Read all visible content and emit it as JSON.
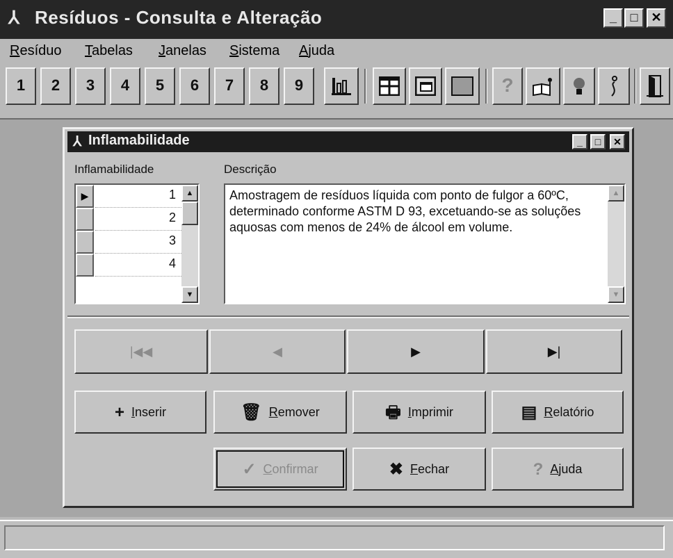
{
  "window": {
    "title": "Resíduos - Consulta e Alteração",
    "app_icon": "person-icon",
    "controls": {
      "minimize": "_",
      "maximize": "□",
      "close": "✕"
    }
  },
  "menu": {
    "items": [
      {
        "accel": "R",
        "rest": "esíduo"
      },
      {
        "accel": "T",
        "rest": "abelas"
      },
      {
        "accel": "J",
        "rest": "anelas"
      },
      {
        "accel": "S",
        "rest": "istema"
      },
      {
        "accel": "A",
        "rest": "juda"
      }
    ]
  },
  "toolbar": {
    "numbers": [
      "1",
      "2",
      "3",
      "4",
      "5",
      "6",
      "7",
      "8",
      "9"
    ],
    "icons": [
      "chart-icon",
      "tile-icon",
      "cascade-icon",
      "window-icon",
      "help-icon",
      "info-book-icon",
      "tip-icon",
      "about-icon",
      "exit-icon"
    ]
  },
  "dialog": {
    "title": "Inflamabilidade",
    "controls": {
      "minimize": "_",
      "maximize": "□",
      "close": "✕"
    },
    "grid_label": "Inflamabilidade",
    "memo_label": "Descrição",
    "rows": [
      "1",
      "2",
      "3",
      "4"
    ],
    "current_row_marker": "▶",
    "description": "Amostragem de resíduos líquida com ponto de fulgor a 60ºC, determinado conforme ASTM D 93, excetuando-se as soluções aquosas com menos de 24% de álcool em volume.",
    "nav": {
      "first": "|◀◀",
      "prior": "◀",
      "next": "▶",
      "last": "▶|"
    },
    "buttons": {
      "insert": {
        "icon": "+",
        "accel": "I",
        "rest": "nserir"
      },
      "remove": {
        "icon": "🗑",
        "accel": "R",
        "rest": "emover"
      },
      "print": {
        "icon": "🖶",
        "accel": "I",
        "rest": "mprimir"
      },
      "report": {
        "icon": "▤",
        "accel": "R",
        "rest": "elatório"
      },
      "confirm": {
        "icon": "✓",
        "accel": "C",
        "rest": "onfirmar"
      },
      "close": {
        "icon": "✖",
        "accel": "F",
        "rest": "echar"
      },
      "help": {
        "icon": "?",
        "accel": "A",
        "rest": "juda"
      }
    }
  }
}
